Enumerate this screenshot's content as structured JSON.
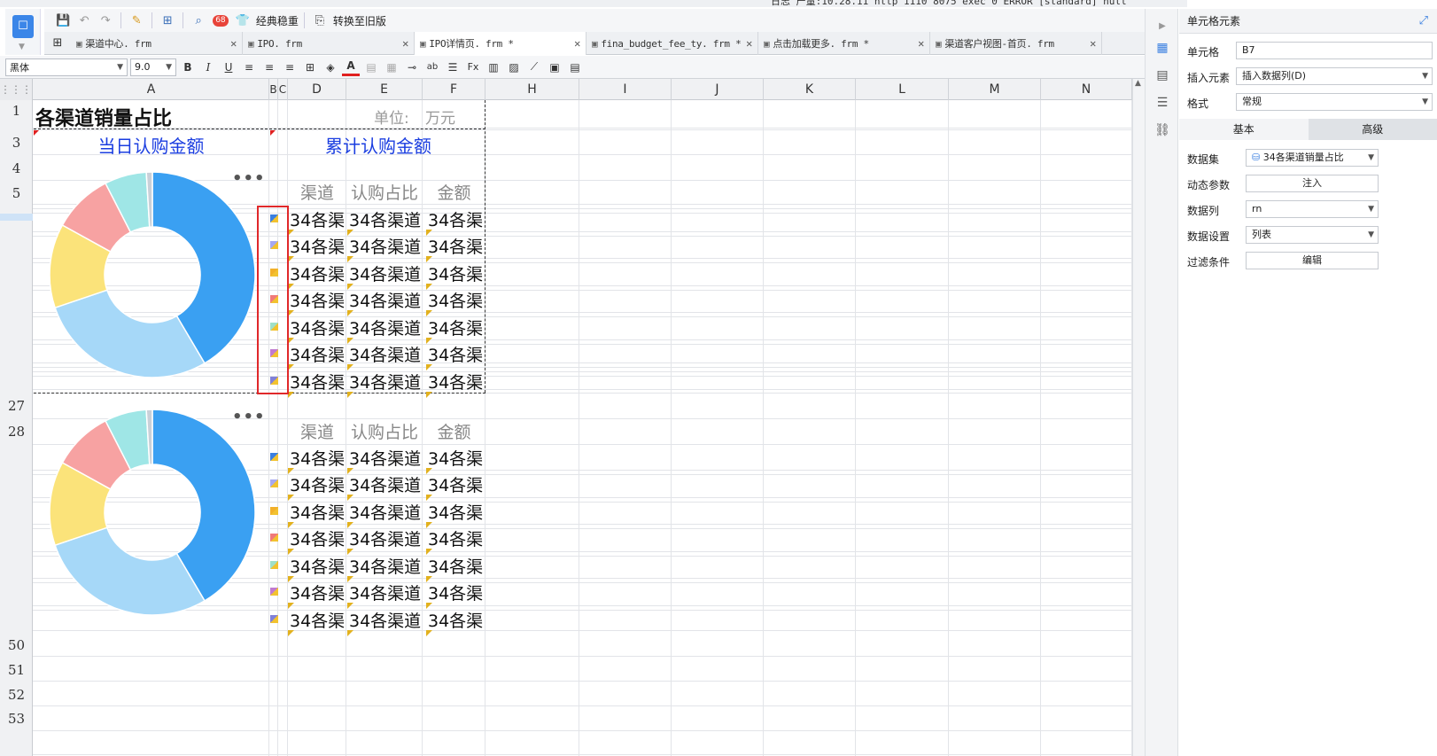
{
  "top_strip_text": "日志  产量:10.28.11 http 1110 8075 exec 0 ERROR [standard] null",
  "toolbar": {
    "classic_label": "经典稳重",
    "convert_label": "转换至旧版",
    "badge_count": "68"
  },
  "tabs": [
    {
      "label": "渠道中心. frm",
      "active": false
    },
    {
      "label": "IPO. frm",
      "active": false
    },
    {
      "label": "IPO详情页. frm *",
      "active": true
    },
    {
      "label": "fina_budget_fee_ty. frm *",
      "active": false
    },
    {
      "label": "点击加载更多. frm *",
      "active": false
    },
    {
      "label": "渠道客户视图-首页. frm",
      "active": false
    }
  ],
  "format": {
    "font": "黑体",
    "size": "9.0"
  },
  "columns": [
    "A",
    "B",
    "C",
    "D",
    "E",
    "F",
    "H",
    "I",
    "J",
    "K",
    "L",
    "M",
    "N"
  ],
  "rows": [
    "1",
    "3",
    "4",
    "5",
    "27",
    "28",
    "50",
    "51",
    "52",
    "53"
  ],
  "sheet": {
    "title": "各渠道销量占比",
    "unit_label": "单位:",
    "unit_value": "万元",
    "daily_label": "当日认购金额",
    "cumulative_label": "累计认购金额",
    "hdr_channel": "渠道",
    "hdr_ratio": "认购占比",
    "hdr_amount": "金额",
    "cell_short": "34各渠",
    "cell_long": "34各渠道"
  },
  "chart_data": [
    {
      "type": "pie",
      "title": "",
      "categories": [
        "",
        "",
        "",
        "",
        "",
        ""
      ],
      "values": [
        44,
        30,
        14,
        10,
        7,
        1
      ],
      "colors": [
        "#3aa0f2",
        "#a6d8f8",
        "#fbe37a",
        "#f7a2a2",
        "#9fe6e6",
        "#c9d0d8"
      ]
    },
    {
      "type": "pie",
      "title": "",
      "categories": [
        "",
        "",
        "",
        "",
        "",
        ""
      ],
      "values": [
        44,
        30,
        14,
        10,
        7,
        1
      ],
      "colors": [
        "#3aa0f2",
        "#a6d8f8",
        "#fbe37a",
        "#f7a2a2",
        "#9fe6e6",
        "#c9d0d8"
      ]
    }
  ],
  "panel": {
    "title": "单元格元素",
    "cell_label": "单元格",
    "cell_value": "B7",
    "insert_label": "插入元素",
    "insert_value": "插入数据列(D)",
    "format_label": "格式",
    "format_value": "常规",
    "tab_basic": "基本",
    "tab_advanced": "高级",
    "dataset_label": "数据集",
    "dataset_value": "34各渠道销量占比",
    "param_label": "动态参数",
    "param_button": "注入",
    "column_label": "数据列",
    "column_value": "rn",
    "setting_label": "数据设置",
    "setting_value": "列表",
    "filter_label": "过滤条件",
    "filter_button": "编辑"
  },
  "accent_color": "#3a7fe0"
}
